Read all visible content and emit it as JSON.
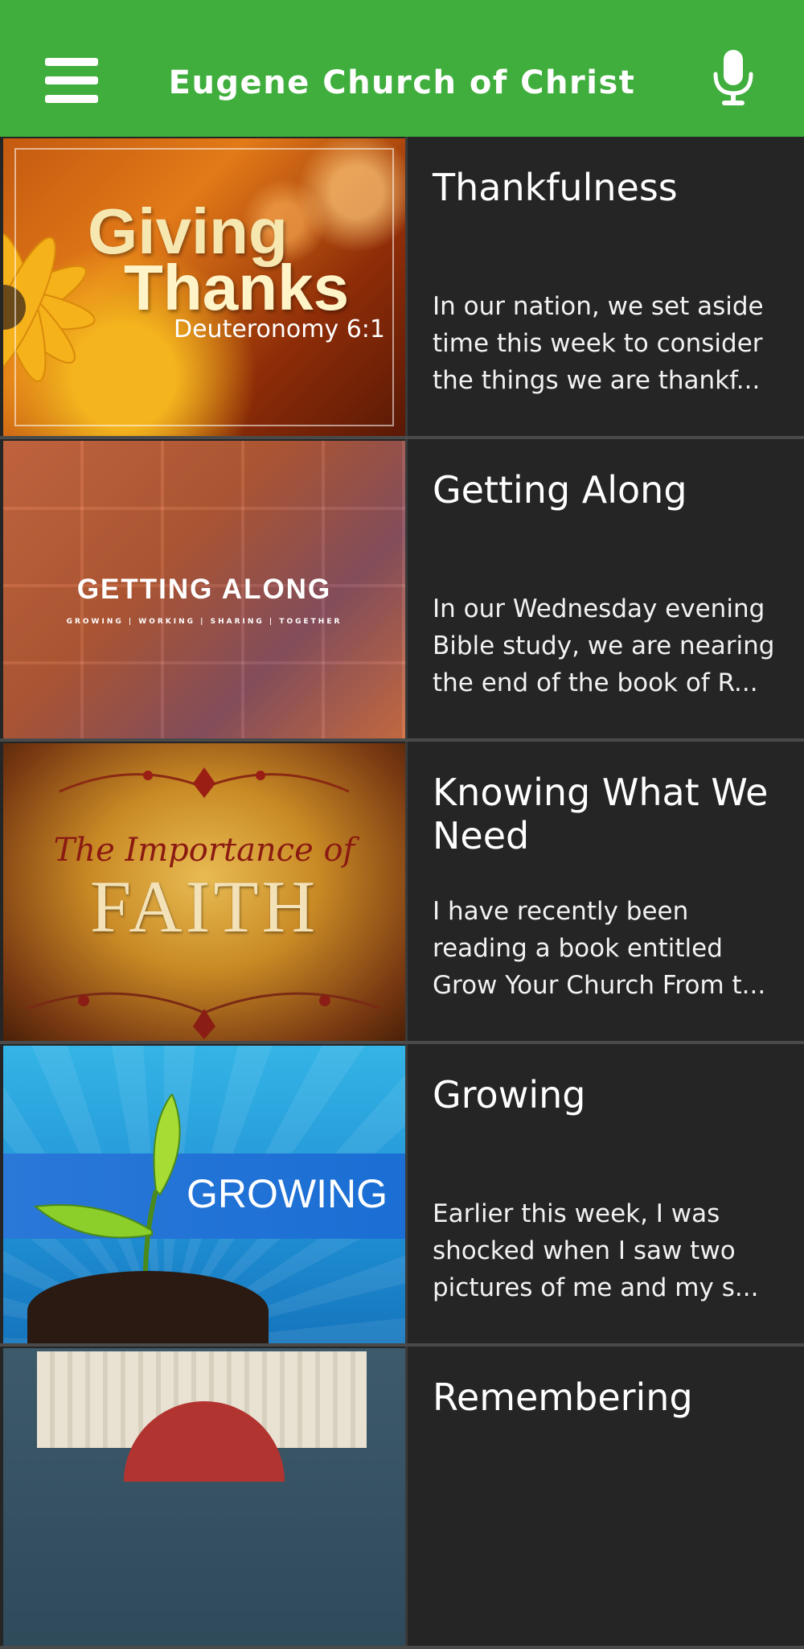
{
  "app": {
    "title": "Eugene Church of Christ",
    "brand_color": "#3fae3c",
    "menu_icon": "hamburger-menu-icon",
    "mic_icon": "microphone-icon"
  },
  "posts": [
    {
      "title": "Thankfulness",
      "excerpt": "In our nation, we set aside time this week to consider the things we are thankf...",
      "thumb": {
        "line1": "Giving",
        "line2": "Thanks",
        "line3": "Deuteronomy 6:1"
      }
    },
    {
      "title": "Getting Along",
      "excerpt": "In our Wednesday evening Bible study, we are nearing the end of the book of R...",
      "thumb": {
        "line1": "GETTING ALONG",
        "line2": "GROWING | WORKING | SHARING | TOGETHER"
      }
    },
    {
      "title": "Knowing What We Need",
      "excerpt": "I have recently been reading a book entitled Grow Your Church From t...",
      "thumb": {
        "line1": "The Importance of",
        "line2": "FAITH"
      }
    },
    {
      "title": "Growing",
      "excerpt": "Earlier this week, I was shocked when I saw two pictures of me and my s...",
      "thumb": {
        "line1": "GROWING"
      }
    },
    {
      "title": "Remembering",
      "excerpt": "",
      "thumb": {}
    }
  ]
}
